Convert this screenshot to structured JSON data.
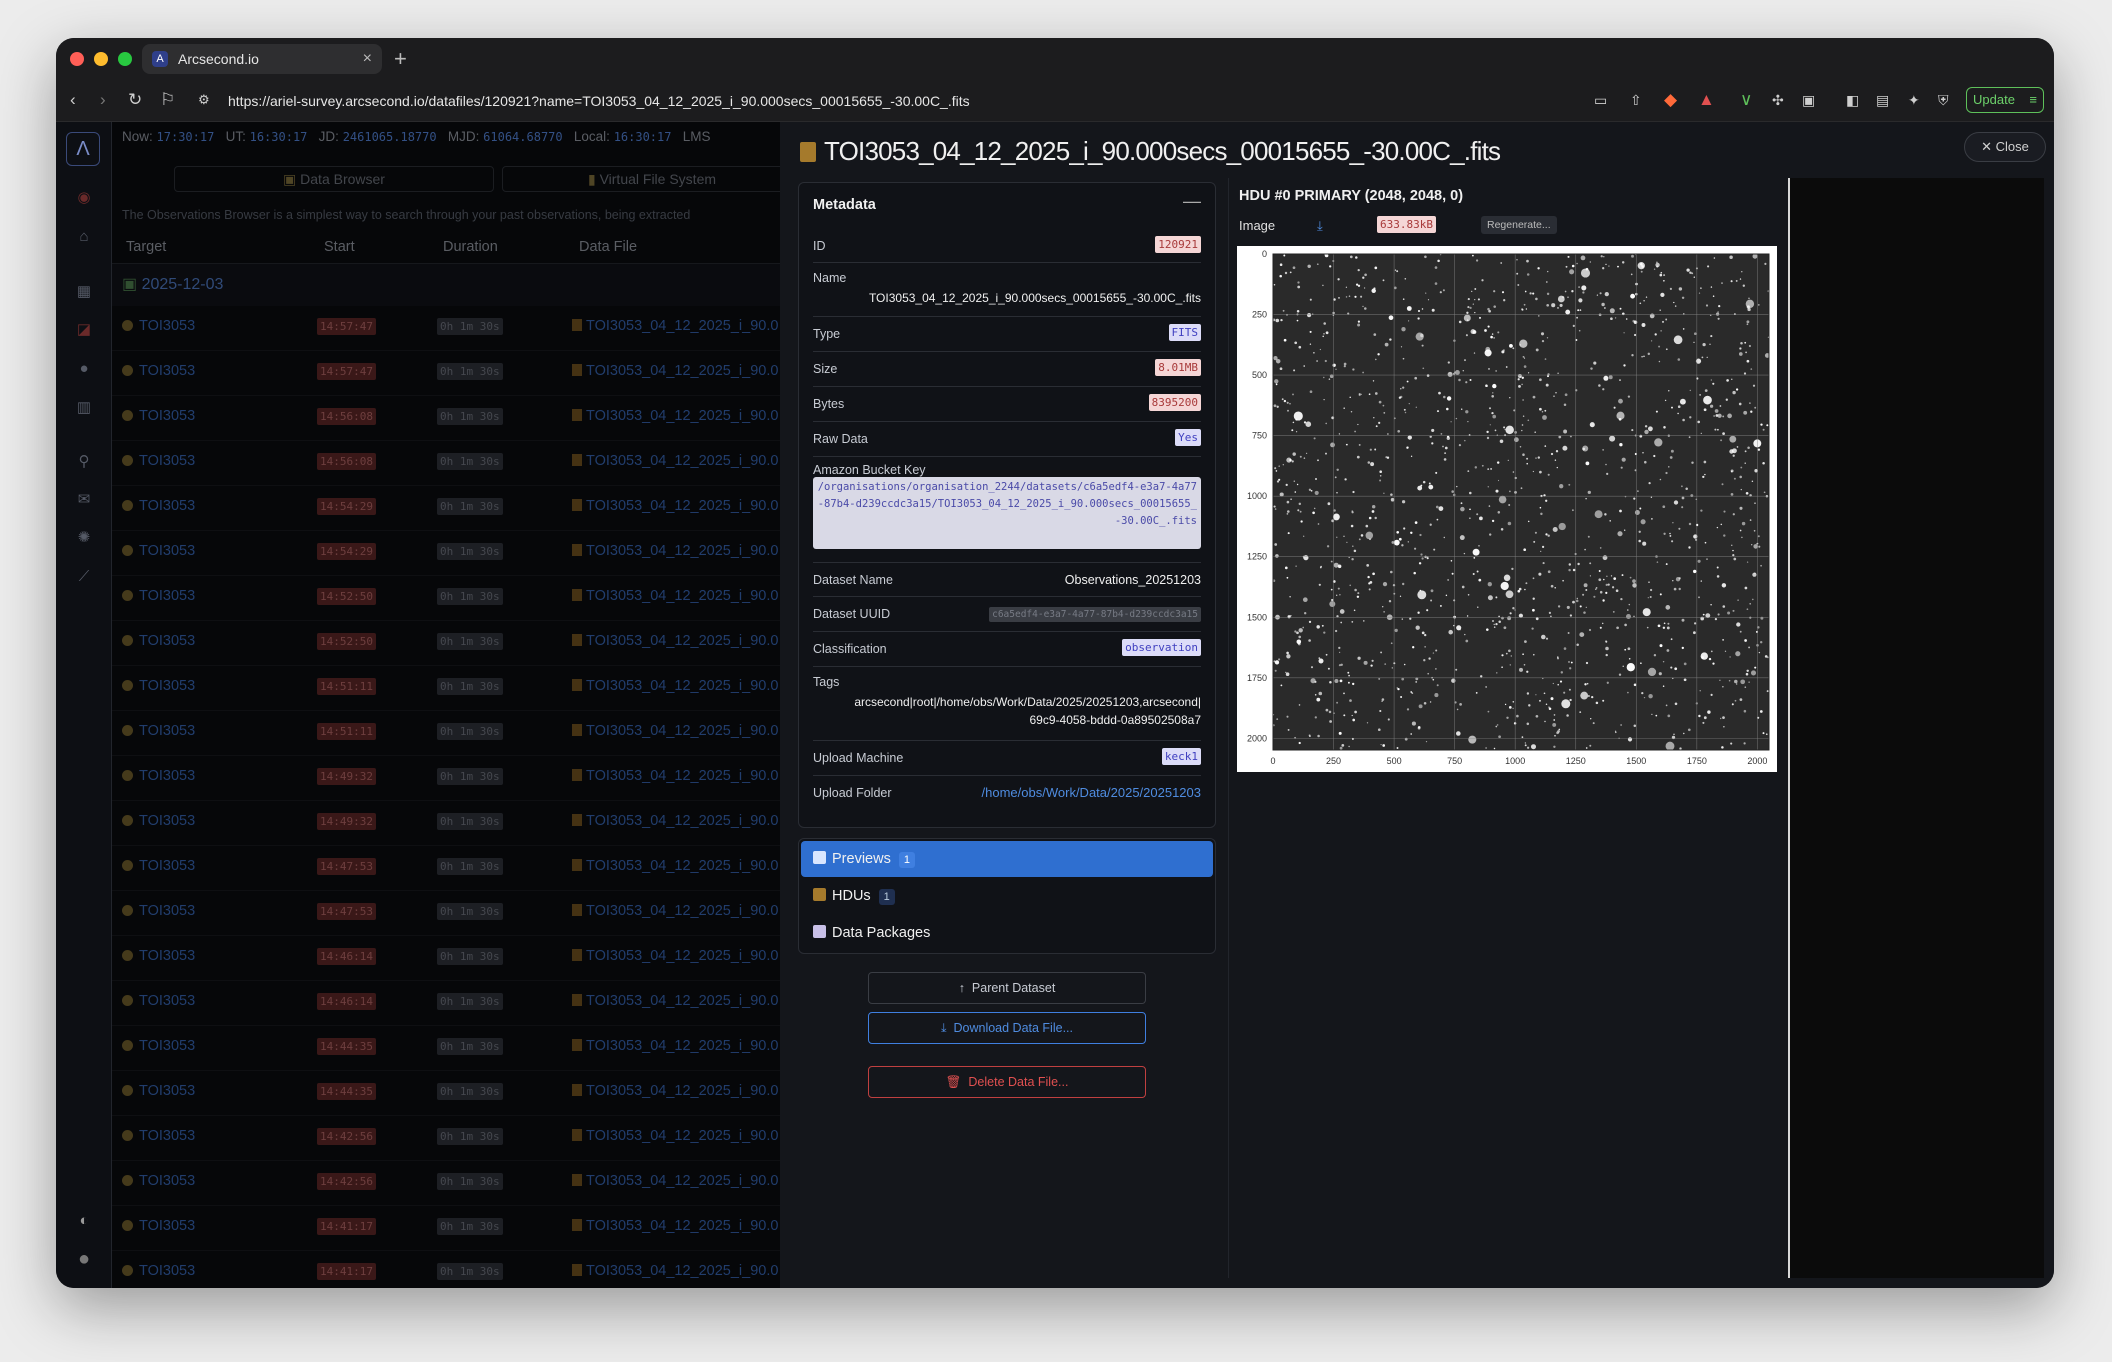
{
  "browser": {
    "tab_title": "Arcsecond.io",
    "tab_favicon": "A",
    "url": "https://ariel-survey.arcsecond.io/datafiles/120921?name=TOI3053_04_12_2025_i_90.000secs_00015655_-30.00C_.fits",
    "update_label": "Update"
  },
  "timebar": {
    "now_label": "Now:",
    "now": "17:30:17",
    "ut_label": "UT:",
    "ut": "16:30:17",
    "jd_label": "JD:",
    "jd": "2461065.18770",
    "mjd_label": "MJD:",
    "mjd": "61064.68770",
    "local_label": "Local:",
    "local": "16:30:17",
    "lmst_label": "LMS"
  },
  "left": {
    "data_browser_btn": "Data Browser",
    "vfs_btn": "Virtual File System",
    "description": "The Observations Browser is a simplest way to search through your past observations, being extracted",
    "columns": [
      "Target",
      "Start",
      "Duration",
      "Data File"
    ],
    "date_group": "2025-12-03",
    "rows": [
      {
        "target": "TOI3053",
        "start": "14:57:47",
        "duration": "0h 1m 30s",
        "file": "TOI3053_04_12_2025_i_90.0"
      },
      {
        "target": "TOI3053",
        "start": "14:57:47",
        "duration": "0h 1m 30s",
        "file": "TOI3053_04_12_2025_i_90.0"
      },
      {
        "target": "TOI3053",
        "start": "14:56:08",
        "duration": "0h 1m 30s",
        "file": "TOI3053_04_12_2025_i_90.0"
      },
      {
        "target": "TOI3053",
        "start": "14:56:08",
        "duration": "0h 1m 30s",
        "file": "TOI3053_04_12_2025_i_90.0"
      },
      {
        "target": "TOI3053",
        "start": "14:54:29",
        "duration": "0h 1m 30s",
        "file": "TOI3053_04_12_2025_i_90.0"
      },
      {
        "target": "TOI3053",
        "start": "14:54:29",
        "duration": "0h 1m 30s",
        "file": "TOI3053_04_12_2025_i_90.0"
      },
      {
        "target": "TOI3053",
        "start": "14:52:50",
        "duration": "0h 1m 30s",
        "file": "TOI3053_04_12_2025_i_90.0"
      },
      {
        "target": "TOI3053",
        "start": "14:52:50",
        "duration": "0h 1m 30s",
        "file": "TOI3053_04_12_2025_i_90.0"
      },
      {
        "target": "TOI3053",
        "start": "14:51:11",
        "duration": "0h 1m 30s",
        "file": "TOI3053_04_12_2025_i_90.0"
      },
      {
        "target": "TOI3053",
        "start": "14:51:11",
        "duration": "0h 1m 30s",
        "file": "TOI3053_04_12_2025_i_90.0"
      },
      {
        "target": "TOI3053",
        "start": "14:49:32",
        "duration": "0h 1m 30s",
        "file": "TOI3053_04_12_2025_i_90.0"
      },
      {
        "target": "TOI3053",
        "start": "14:49:32",
        "duration": "0h 1m 30s",
        "file": "TOI3053_04_12_2025_i_90.0"
      },
      {
        "target": "TOI3053",
        "start": "14:47:53",
        "duration": "0h 1m 30s",
        "file": "TOI3053_04_12_2025_i_90.0"
      },
      {
        "target": "TOI3053",
        "start": "14:47:53",
        "duration": "0h 1m 30s",
        "file": "TOI3053_04_12_2025_i_90.0"
      },
      {
        "target": "TOI3053",
        "start": "14:46:14",
        "duration": "0h 1m 30s",
        "file": "TOI3053_04_12_2025_i_90.0"
      },
      {
        "target": "TOI3053",
        "start": "14:46:14",
        "duration": "0h 1m 30s",
        "file": "TOI3053_04_12_2025_i_90.0"
      },
      {
        "target": "TOI3053",
        "start": "14:44:35",
        "duration": "0h 1m 30s",
        "file": "TOI3053_04_12_2025_i_90.0"
      },
      {
        "target": "TOI3053",
        "start": "14:44:35",
        "duration": "0h 1m 30s",
        "file": "TOI3053_04_12_2025_i_90.0"
      },
      {
        "target": "TOI3053",
        "start": "14:42:56",
        "duration": "0h 1m 30s",
        "file": "TOI3053_04_12_2025_i_90.0"
      },
      {
        "target": "TOI3053",
        "start": "14:42:56",
        "duration": "0h 1m 30s",
        "file": "TOI3053_04_12_2025_i_90.0"
      },
      {
        "target": "TOI3053",
        "start": "14:41:17",
        "duration": "0h 1m 30s",
        "file": "TOI3053_04_12_2025_i_90.0"
      },
      {
        "target": "TOI3053",
        "start": "14:41:17",
        "duration": "0h 1m 30s",
        "file": "TOI3053_04_12_2025_i_90.0"
      }
    ]
  },
  "drawer": {
    "title": "TOI3053_04_12_2025_i_90.000secs_00015655_-30.00C_.fits",
    "close_label": "Close",
    "metadata": {
      "heading": "Metadata",
      "id_label": "ID",
      "id": "120921",
      "name_label": "Name",
      "name": "TOI3053_04_12_2025_i_90.000secs_00015655_-30.00C_.fits",
      "type_label": "Type",
      "type": "FITS",
      "size_label": "Size",
      "size": "8.01MB",
      "bytes_label": "Bytes",
      "bytes": "8395200",
      "raw_label": "Raw Data",
      "raw": "Yes",
      "bucket_label": "Amazon Bucket Key",
      "bucket": "/organisations/organisation_2244/datasets/c6a5edf4-e3a7-4a77-87b4-d239ccdc3a15/TOI3053_04_12_2025_i_90.000secs_00015655_-30.00C_.fits",
      "dataset_name_label": "Dataset Name",
      "dataset_name": "Observations_20251203",
      "dataset_uuid_label": "Dataset UUID",
      "dataset_uuid": "c6a5edf4-e3a7-4a77-87b4-d239ccdc3a15",
      "class_label": "Classification",
      "classification": "observation",
      "tags_label": "Tags",
      "tags_line1": "arcsecond|root|/home/obs/Work/Data/2025/20251203,arcsecond|",
      "tags_line2": "69c9-4058-bddd-0a89502508a7",
      "machine_label": "Upload Machine",
      "machine": "keck1",
      "folder_label": "Upload Folder",
      "folder": "/home/obs/Work/Data/2025/20251203"
    },
    "tabs": [
      {
        "label": "Previews",
        "count": "1"
      },
      {
        "label": "HDUs",
        "count": "1"
      },
      {
        "label": "Data Packages"
      }
    ],
    "actions": {
      "parent": "Parent Dataset",
      "download": "Download Data File...",
      "delete": "Delete Data File..."
    },
    "hdu": {
      "title": "HDU #0 PRIMARY (2048, 2048, 0)",
      "image_label": "Image",
      "image_size": "633.83kB",
      "regenerate": "Regenerate..."
    }
  },
  "chart_data": {
    "type": "heatmap",
    "x_ticks": [
      "0",
      "250",
      "500",
      "750",
      "1000",
      "1250",
      "1500",
      "1750",
      "2000"
    ],
    "y_ticks": [
      "0",
      "250",
      "500",
      "750",
      "1000",
      "1250",
      "1500",
      "1750",
      "2000"
    ],
    "xlim": [
      0,
      2048
    ],
    "ylim": [
      0,
      2048
    ],
    "grid": true,
    "colormap": "grayscale"
  },
  "colors": {
    "accent": "#2f6fd0",
    "danger": "#e05050",
    "link": "#4f8ce0"
  }
}
